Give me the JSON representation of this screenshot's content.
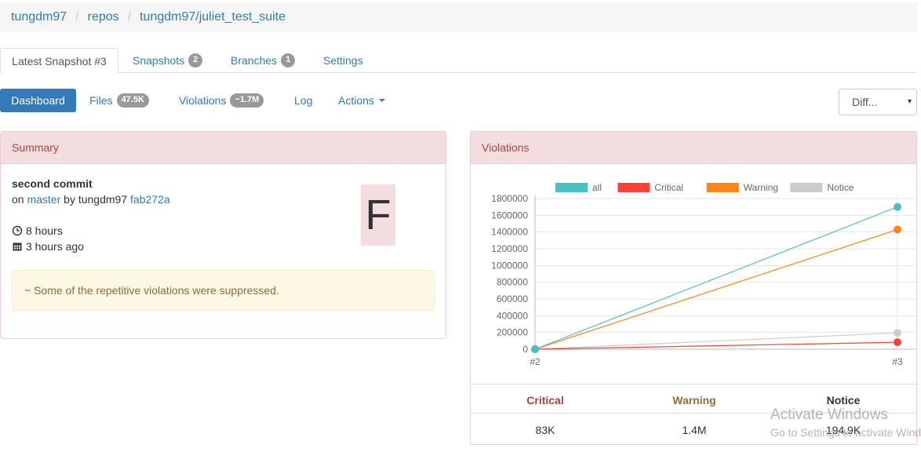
{
  "breadcrumb": [
    "tungdm97",
    "repos",
    "tungdm97/juliet_test_suite"
  ],
  "tabs": [
    {
      "label": "Latest Snapshot #3"
    },
    {
      "label": "Snapshots",
      "badge": "2"
    },
    {
      "label": "Branches",
      "badge": "1"
    },
    {
      "label": "Settings"
    }
  ],
  "pills": {
    "dashboard": "Dashboard",
    "files": "Files",
    "files_badge": "47.5K",
    "violations": "Violations",
    "violations_badge": "~1.7M",
    "log": "Log",
    "actions": "Actions"
  },
  "diff_select": "Diff...",
  "summary": {
    "heading": "Summary",
    "commit_title": "second commit",
    "on": "on",
    "branch": "master",
    "by": "by",
    "author": "tungdm97",
    "hash": "fab272a",
    "duration": "8 hours",
    "time_ago": "3 hours ago",
    "grade": "F",
    "alert": "~ Some of the repetitive violations were suppressed."
  },
  "violations_panel": {
    "heading": "Violations",
    "stats": [
      {
        "label": "Critical",
        "value": "83K",
        "color": "#a94442"
      },
      {
        "label": "Warning",
        "value": "1.4M",
        "color": "#8a6d3b"
      },
      {
        "label": "Notice",
        "value": "194.9K",
        "color": "#333333"
      }
    ]
  },
  "chart_data": {
    "type": "line",
    "categories": [
      "#2",
      "#3"
    ],
    "series": [
      {
        "name": "all",
        "values": [
          0,
          1700000
        ],
        "color": "#4bc0c0"
      },
      {
        "name": "Critical",
        "values": [
          0,
          83000
        ],
        "color": "#ff4136"
      },
      {
        "name": "Warning",
        "values": [
          0,
          1430000
        ],
        "color": "#ff851b"
      },
      {
        "name": "Notice",
        "values": [
          0,
          194900
        ],
        "color": "#cccccc"
      }
    ],
    "yticks": [
      0,
      200000,
      400000,
      600000,
      800000,
      1000000,
      1200000,
      1400000,
      1600000,
      1800000
    ],
    "ylim": [
      0,
      1800000
    ],
    "legend": "top",
    "grid": true
  },
  "watermark": {
    "line1": "Activate Windows",
    "line2": "Go to Settings to activate Windows."
  }
}
